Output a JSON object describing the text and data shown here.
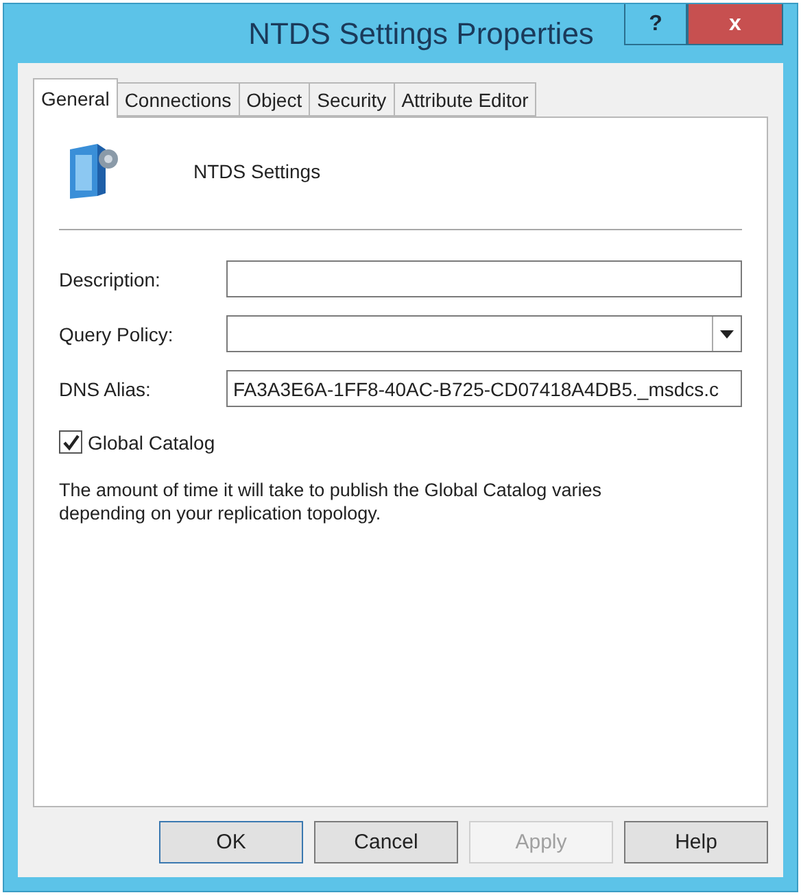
{
  "window": {
    "title": "NTDS Settings Properties",
    "help_button": "?",
    "close_button": "x"
  },
  "tabs": [
    {
      "label": "General",
      "selected": true
    },
    {
      "label": "Connections",
      "selected": false
    },
    {
      "label": "Object",
      "selected": false
    },
    {
      "label": "Security",
      "selected": false
    },
    {
      "label": "Attribute Editor",
      "selected": false
    }
  ],
  "object_name": "NTDS Settings",
  "fields": [
    {
      "kind": "text",
      "label": "Description:"
    },
    {
      "kind": "dropdown",
      "label": "Query Policy:"
    },
    {
      "kind": "text",
      "label": "DNS Alias:",
      "value": "FA3A3E6A-1FF8-40AC-B725-CD07418A4DB5._msdcs.c"
    }
  ],
  "global_catalog": {
    "label": "Global Catalog",
    "checked": true
  },
  "note": "The amount of time it will take to publish the Global Catalog varies depending on your replication topology.",
  "buttons": [
    {
      "label": "OK",
      "disabled": false,
      "default": true
    },
    {
      "label": "Cancel",
      "disabled": false,
      "default": false
    },
    {
      "label": "Apply",
      "disabled": true,
      "default": false
    },
    {
      "label": "Help",
      "disabled": false,
      "default": false
    }
  ]
}
